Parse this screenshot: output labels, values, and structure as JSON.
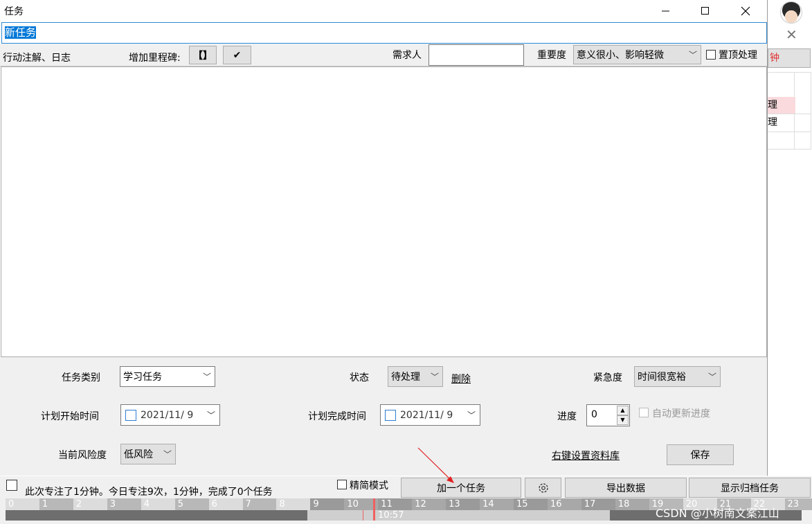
{
  "window": {
    "title": "任务"
  },
  "task_name": {
    "value": "新任务"
  },
  "toolbar": {
    "notes_label": "行动注解、日志",
    "milestone_label": "增加里程碑:",
    "milestone_btn": "【】",
    "check_btn": "✔",
    "requester_label": "需求人",
    "requester_value": "",
    "importance_label": "重要度",
    "importance_value": "意义很小、影响轻微",
    "pin_label": "置顶处理"
  },
  "form": {
    "category_label": "任务类别",
    "category_value": "学习任务",
    "status_label": "状态",
    "status_value": "待处理",
    "delete_link": "删除",
    "urgency_label": "紧急度",
    "urgency_value": "时间很宽裕",
    "plan_start_label": "计划开始时间",
    "plan_start_value": "2021/11/  9",
    "plan_end_label": "计划完成时间",
    "plan_end_value": "2021/11/  9",
    "progress_label": "进度",
    "progress_value": "0",
    "auto_progress_label": "自动更新进度",
    "risk_label": "当前风险度",
    "risk_value": "低风险",
    "library_link": "右键设置资料库",
    "save_btn": "保存"
  },
  "bottom": {
    "focus_text": "此次专注了1分钟。今日专注9次，1分钟，完成了0个任务",
    "simple_mode_label": "精简模式",
    "add_task_btn": "加一个任务",
    "export_btn": "导出数据",
    "archive_btn": "显示归档任务",
    "current_time": "10:57",
    "hours": [
      "0",
      "1",
      "2",
      "3",
      "4",
      "5",
      "6",
      "7",
      "8",
      "9",
      "10",
      "11",
      "12",
      "13",
      "14",
      "15",
      "16",
      "17",
      "18",
      "19",
      "20",
      "21",
      "22",
      "23"
    ],
    "watermark": "CSDN @小树南文案江山"
  },
  "background_app": {
    "btn_text": "钟",
    "rows": [
      "理",
      "理"
    ]
  },
  "colors": {
    "accent": "#0078d7",
    "arrow": "#e02020"
  }
}
